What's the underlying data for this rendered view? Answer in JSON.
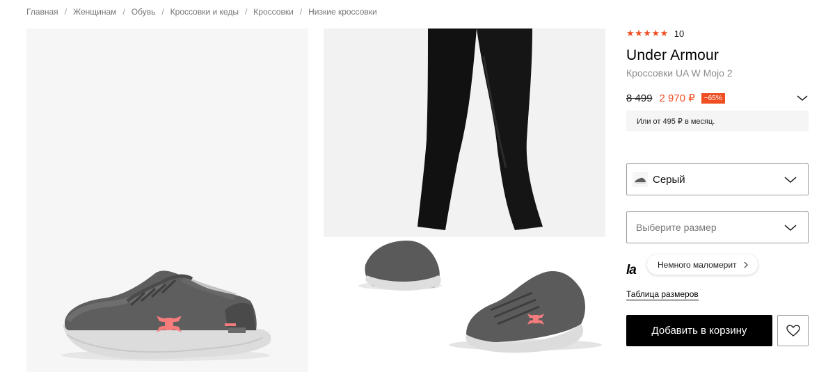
{
  "breadcrumb": {
    "separator": "/",
    "items": [
      "Главная",
      "Женщинам",
      "Обувь",
      "Кроссовки и кеды",
      "Кроссовки",
      "Низкие кроссовки"
    ]
  },
  "product": {
    "rating_stars": "★★★★★",
    "rating": 5,
    "reviews_count": "10",
    "brand": "Under Armour",
    "name": "Кроссовки UA W Mojo 2",
    "old_price": "8 499",
    "new_price": "2 970 ₽",
    "discount": "−65%",
    "installment": "Или от 495 ₽ в месяц."
  },
  "color_select": {
    "value": "Серый"
  },
  "size_select": {
    "placeholder": "Выберите размер"
  },
  "fit": {
    "logo": "la",
    "label": "Немного маломерит"
  },
  "size_table_link": "Таблица размеров",
  "actions": {
    "add_to_cart": "Добавить в корзину"
  },
  "colors": {
    "accent": "#f04f23",
    "button": "#000000",
    "border": "#9c9c9c",
    "muted": "#8c8c8c"
  }
}
